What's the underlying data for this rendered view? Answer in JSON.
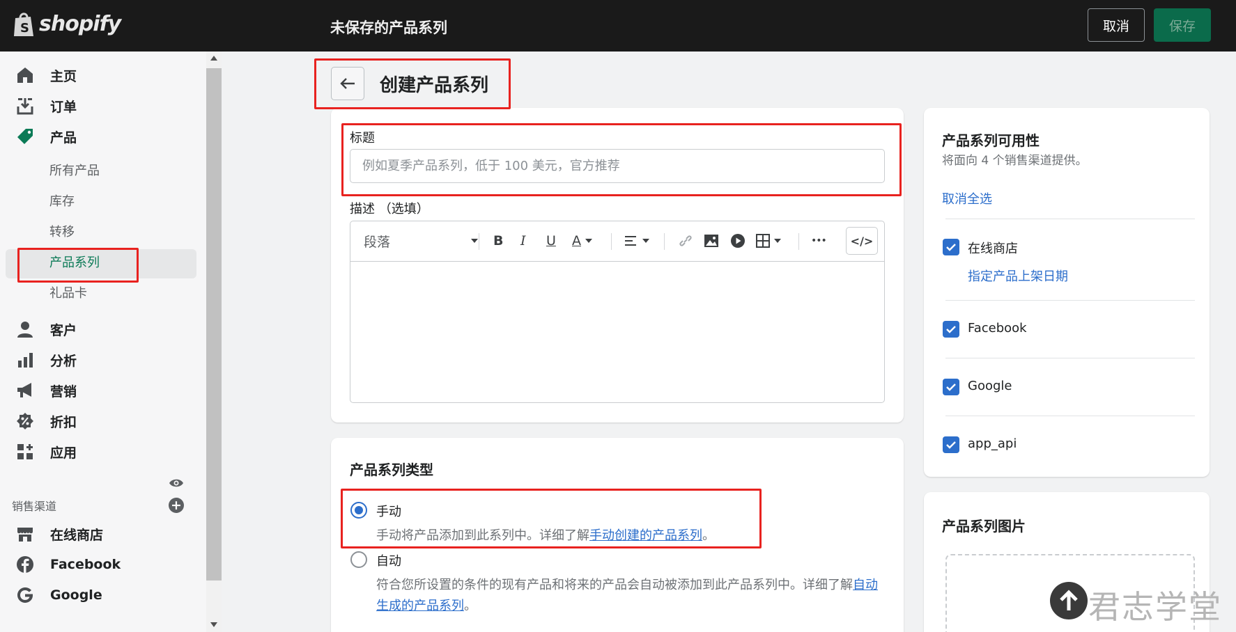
{
  "topbar": {
    "logo_text": "shopify",
    "page_status": "未保存的产品系列",
    "cancel_label": "取消",
    "save_label": "保存"
  },
  "sidebar": {
    "items": [
      {
        "label": "主页",
        "icon": "home-icon"
      },
      {
        "label": "订单",
        "icon": "orders-icon"
      },
      {
        "label": "产品",
        "icon": "tag-icon"
      },
      {
        "label": "客户",
        "icon": "person-icon"
      },
      {
        "label": "分析",
        "icon": "bar-chart-icon"
      },
      {
        "label": "营销",
        "icon": "megaphone-icon"
      },
      {
        "label": "折扣",
        "icon": "discount-icon"
      },
      {
        "label": "应用",
        "icon": "apps-icon"
      }
    ],
    "product_sub": [
      "所有产品",
      "库存",
      "转移",
      "产品系列",
      "礼品卡"
    ],
    "sales_channels_label": "销售渠道",
    "channels": [
      {
        "label": "在线商店",
        "icon": "store-icon"
      },
      {
        "label": "Facebook",
        "icon": "facebook-icon"
      },
      {
        "label": "Google",
        "icon": "google-icon"
      }
    ]
  },
  "header": {
    "title": "创建产品系列"
  },
  "form": {
    "title_label": "标题",
    "title_placeholder": "例如夏季产品系列，低于 100 美元，官方推荐",
    "desc_label": "描述 （选填）",
    "toolbar": {
      "paragraph": "段落",
      "bold": "B",
      "italic": "I",
      "underline": "U",
      "color": "A",
      "more": "•••",
      "code": "</>"
    }
  },
  "collection_type": {
    "heading": "产品系列类型",
    "manual_label": "手动",
    "manual_help_prefix": "手动将产品添加到此系列中。详细了解",
    "manual_help_link": "手动创建的产品系列",
    "manual_help_suffix": "。",
    "auto_label": "自动",
    "auto_help_prefix": "符合您所设置的条件的现有产品和将来的产品会自动被添加到此产品系列中。详细了解",
    "auto_help_link": "自动生成的产品系列",
    "auto_help_suffix": "。",
    "selected": "manual"
  },
  "availability": {
    "heading": "产品系列可用性",
    "subtext": "将面向 4 个销售渠道提供。",
    "deselect_all": "取消全选",
    "channels": [
      {
        "label": "在线商店",
        "checked": true
      },
      {
        "label": "Facebook",
        "checked": true
      },
      {
        "label": "Google",
        "checked": true
      },
      {
        "label": "app_api",
        "checked": true
      }
    ],
    "schedule_link": "指定产品上架日期"
  },
  "image_card": {
    "heading": "产品系列图片"
  },
  "watermark": {
    "text": "君志学堂"
  },
  "colors": {
    "topbar": "#1a1a1a",
    "accent_green": "#0b7a56",
    "link_blue": "#2c6ecb",
    "highlight_red": "#e8221f"
  }
}
